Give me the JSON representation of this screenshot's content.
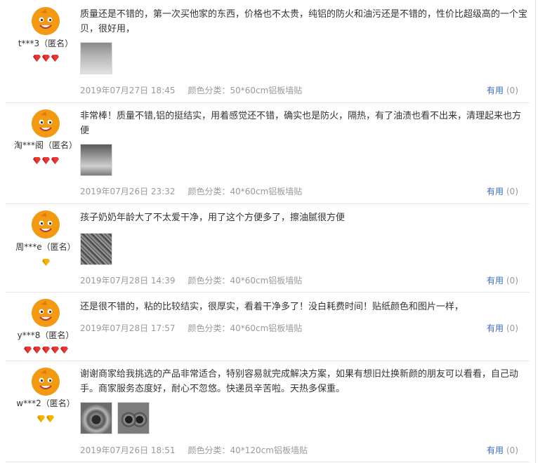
{
  "reviews": [
    {
      "nick": "t***3（匿名）",
      "text": "质量还是不错的，第一次买他家的东西，价格也不太贵，纯铝的防火和油污还是不错的，性价比超级高的一个宝贝，很好用，",
      "date": "2019年07月27日 18:45",
      "sku": "颜色分类：50*60cm铝板墙贴",
      "useful_label": "有用",
      "useful_count": "(0)",
      "rank_icons": [
        "red-diamond-icon",
        "red-diamond-icon",
        "red-diamond-icon"
      ]
    },
    {
      "nick": "淘***阁（匿名）",
      "text": "非常棒！质量不错,铝的挺结实，用着感觉还不错，确实也是防火，隔热，有了油渍也看不出来，清理起来也方便",
      "date": "2019年07月26日 23:32",
      "sku": "颜色分类：40*60cm铝板墙贴",
      "useful_label": "有用",
      "useful_count": "(0)",
      "rank_icons": [
        "red-diamond-icon",
        "red-diamond-icon",
        "red-diamond-icon"
      ]
    },
    {
      "nick": "周***e（匿名）",
      "text": "孩子奶奶年龄大了不太爱干净，用了这个方便多了，擦油腻很方便",
      "date": "2019年07月28日 14:39",
      "sku": "颜色分类：40*60cm铝板墙贴",
      "useful_label": "有用",
      "useful_count": "(0)",
      "rank_icons": [
        "gold-diamond-icon"
      ]
    },
    {
      "nick": "y***8（匿名）",
      "text": "还是很不错的，粘的比较结实，很厚实，看着干净多了！没白耗费时间！贴纸颜色和图片一样，",
      "date": "2019年07月28日 17:57",
      "sku": "颜色分类：40*60cm铝板墙贴",
      "useful_label": "有用",
      "useful_count": "(0)",
      "rank_icons": [
        "red-diamond-icon",
        "red-diamond-icon",
        "red-diamond-icon",
        "red-diamond-icon",
        "red-diamond-icon"
      ]
    },
    {
      "nick": "w***2（匿名）",
      "text": "谢谢商家给我挑选的产品非常适合，特别容易就完成解决方案，如果有想旧灶换新颜的朋友可以看看，自己动手。商家服务态度好，耐心不忽悠。快递员辛苦啦。天热多保重。",
      "date": "2019年07月26日 18:51",
      "sku": "颜色分类：40*120cm铝板墙贴",
      "useful_label": "有用",
      "useful_count": "(0)",
      "rank_icons": [
        "gold-diamond-icon",
        "gold-diamond-icon"
      ]
    }
  ],
  "colors": {
    "avatar": "#f39a15",
    "link": "#3c6ab8",
    "meta": "#9a9a9a",
    "red_diamond": "#e53935",
    "gold_diamond": "#f5b400"
  }
}
